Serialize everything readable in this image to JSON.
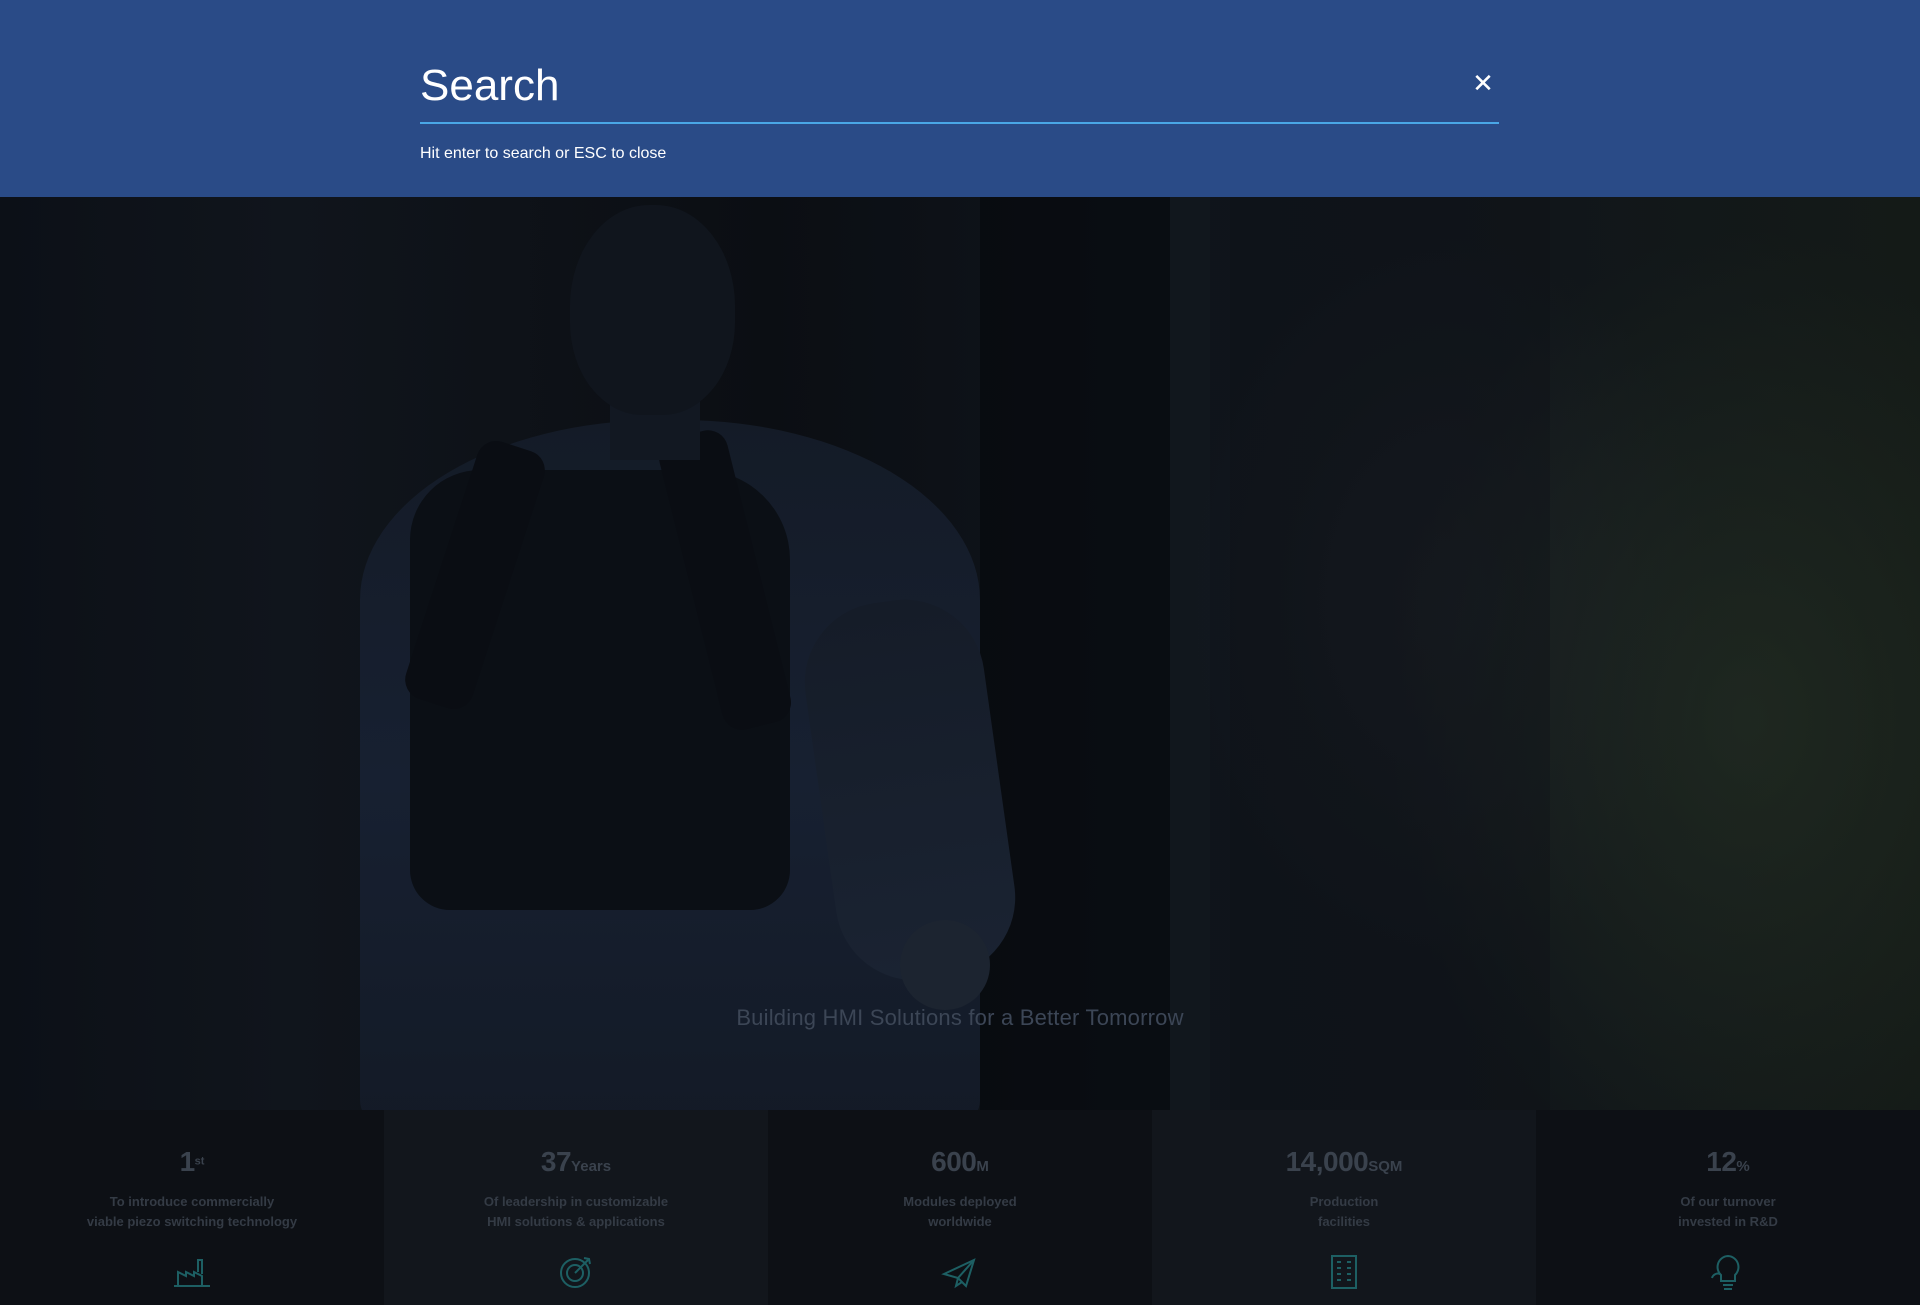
{
  "search": {
    "placeholder": "Search",
    "hint": "Hit enter to search or ESC to close",
    "close_symbol": "✕"
  },
  "hero": {
    "tagline": "Building HMI Solutions for a Better Tomorrow"
  },
  "stats": [
    {
      "number": "1",
      "unit": "st",
      "description": "To introduce commercially\nviable piezo switching technology",
      "icon": "factory-icon"
    },
    {
      "number": "37",
      "unit": "Years",
      "description": "Of leadership in customizable\nHMI solutions & applications",
      "icon": "target-icon"
    },
    {
      "number": "600",
      "unit": "M",
      "description": "Modules deployed\nworldwide",
      "icon": "paper-plane-icon"
    },
    {
      "number": "14,000",
      "unit": "SQM",
      "description": "Production\nfacilities",
      "icon": "building-icon"
    },
    {
      "number": "12",
      "unit": "%",
      "description": "Of our turnover\ninvested in R&D",
      "icon": "lightbulb-icon"
    }
  ],
  "colors": {
    "overlay_background": "#2a4b87",
    "input_underline": "#4aa7e6",
    "icon_teal": "#1d5f63"
  }
}
